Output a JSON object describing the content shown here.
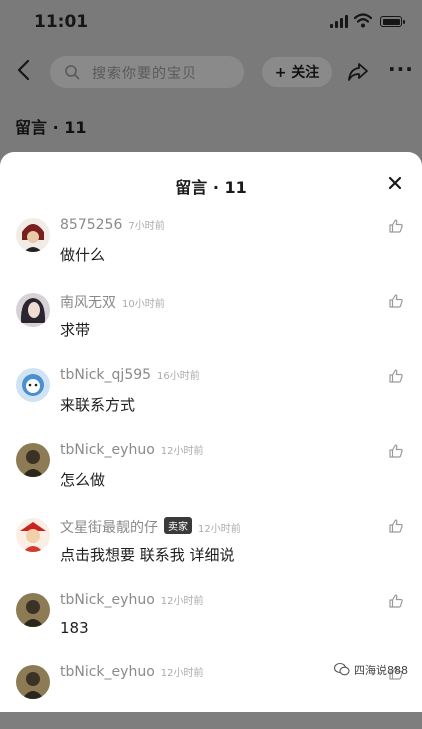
{
  "status_bar": {
    "time": "11:01",
    "icons": [
      "signal-icon",
      "wifi-icon",
      "battery-icon"
    ]
  },
  "nav": {
    "search_placeholder": "搜索你要的宝贝",
    "follow_label": "+ 关注",
    "icons": [
      "back-icon",
      "search-icon",
      "share-icon",
      "more-icon"
    ]
  },
  "background_title": "留言 · 11",
  "sheet": {
    "title": "留言 · 11",
    "close_icon": "close-icon",
    "comments": [
      {
        "user": "8575256",
        "time": "7小时前",
        "text": "做什么",
        "badge": ""
      },
      {
        "user": "南风无双",
        "time": "10小时前",
        "text": "求带",
        "badge": ""
      },
      {
        "user": "tbNick_qj595",
        "time": "16小时前",
        "text": "来联系方式",
        "badge": ""
      },
      {
        "user": "tbNick_eyhuo",
        "time": "12小时前",
        "text": "怎么做",
        "badge": ""
      },
      {
        "user": "文星街最靓的仔",
        "time": "12小时前",
        "text": "点击我想要  联系我  详细说",
        "badge": "卖家"
      },
      {
        "user": "tbNick_eyhuo",
        "time": "12小时前",
        "text": "183",
        "badge": ""
      },
      {
        "user": "tbNick_eyhuo",
        "time": "12小时前",
        "text": "",
        "badge": ""
      }
    ]
  },
  "watermark": {
    "text": "四海说888",
    "icon": "wechat-icon"
  },
  "colors": {
    "overlay": "#7a7a7a",
    "sheet": "#ffffff",
    "username": "#8a8a8a",
    "text": "#1f1f1f"
  }
}
